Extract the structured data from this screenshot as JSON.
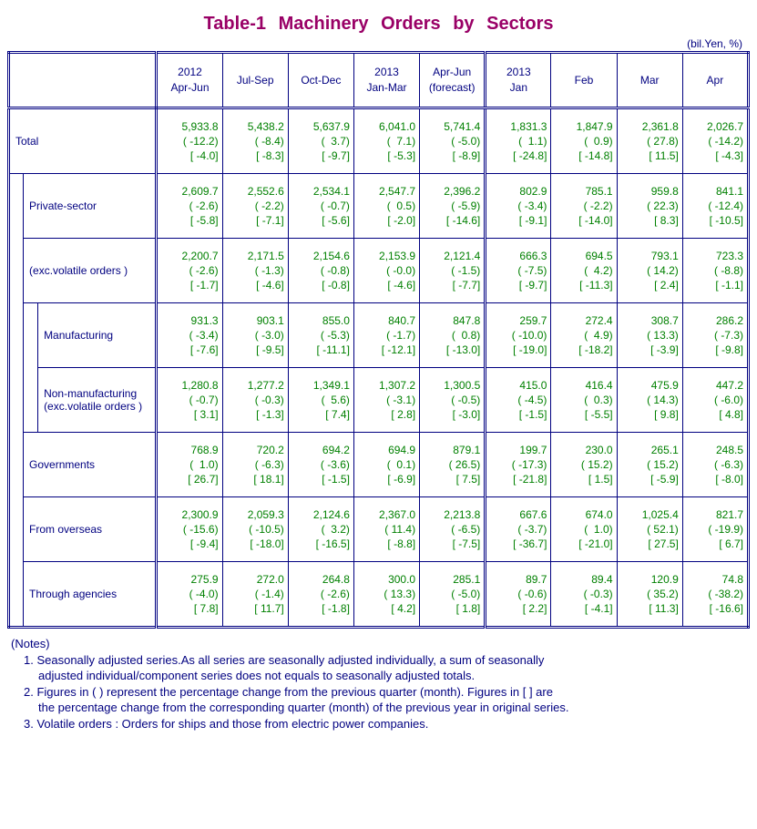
{
  "title": "Table-1   Machinery   Orders   by   Sectors",
  "unit": "(bil.Yen, %)",
  "header": {
    "q": [
      "2012\nApr-Jun",
      "Jul-Sep",
      "Oct-Dec",
      "2013\nJan-Mar",
      "Apr-Jun\n(forecast)"
    ],
    "m": [
      "2013\nJan",
      "Feb",
      "Mar",
      "Apr"
    ]
  },
  "rows": [
    {
      "label": "Total",
      "indent": 0,
      "cells": [
        "5,933.8\n( -12.2)\n[ -4.0]",
        "5,438.2\n( -8.4)\n[ -8.3]",
        "5,637.9\n(  3.7)\n[ -9.7]",
        "6,041.0\n(  7.1)\n[ -5.3]",
        "5,741.4\n( -5.0)\n[ -8.9]",
        "1,831.3\n(  1.1)\n[ -24.8]",
        "1,847.9\n(  0.9)\n[ -14.8]",
        "2,361.8\n( 27.8)\n[ 11.5]",
        "2,026.7\n( -14.2)\n[ -4.3]"
      ]
    },
    {
      "label": "Private-sector",
      "indent": 1,
      "cells": [
        "2,609.7\n( -2.6)\n[ -5.8]",
        "2,552.6\n( -2.2)\n[ -7.1]",
        "2,534.1\n( -0.7)\n[ -5.6]",
        "2,547.7\n(  0.5)\n[ -2.0]",
        "2,396.2\n( -5.9)\n[ -14.6]",
        "802.9\n( -3.4)\n[ -9.1]",
        "785.1\n( -2.2)\n[ -14.0]",
        "959.8\n( 22.3)\n[ 8.3]",
        "841.1\n( -12.4)\n[ -10.5]"
      ]
    },
    {
      "label": "(exc.volatile orders )",
      "indent": 1,
      "cells": [
        "2,200.7\n( -2.6)\n[ -1.7]",
        "2,171.5\n( -1.3)\n[ -4.6]",
        "2,154.6\n( -0.8)\n[ -0.8]",
        "2,153.9\n( -0.0)\n[ -4.6]",
        "2,121.4\n( -1.5)\n[ -7.7]",
        "666.3\n( -7.5)\n[ -9.7]",
        "694.5\n(  4.2)\n[ -11.3]",
        "793.1\n( 14.2)\n[ 2.4]",
        "723.3\n( -8.8)\n[ -1.1]"
      ]
    },
    {
      "label": "Manufacturing",
      "indent": 2,
      "cells": [
        "931.3\n( -3.4)\n[ -7.6]",
        "903.1\n( -3.0)\n[ -9.5]",
        "855.0\n( -5.3)\n[ -11.1]",
        "840.7\n( -1.7)\n[ -12.1]",
        "847.8\n(  0.8)\n[ -13.0]",
        "259.7\n( -10.0)\n[ -19.0]",
        "272.4\n(  4.9)\n[ -18.2]",
        "308.7\n( 13.3)\n[ -3.9]",
        "286.2\n( -7.3)\n[ -9.8]"
      ]
    },
    {
      "label": "Non-manufacturing\n(exc.volatile orders )",
      "indent": 2,
      "cells": [
        "1,280.8\n( -0.7)\n[ 3.1]",
        "1,277.2\n( -0.3)\n[ -1.3]",
        "1,349.1\n(  5.6)\n[ 7.4]",
        "1,307.2\n( -3.1)\n[ 2.8]",
        "1,300.5\n( -0.5)\n[ -3.0]",
        "415.0\n( -4.5)\n[ -1.5]",
        "416.4\n(  0.3)\n[ -5.5]",
        "475.9\n( 14.3)\n[ 9.8]",
        "447.2\n( -6.0)\n[ 4.8]"
      ]
    },
    {
      "label": "Governments",
      "indent": 1,
      "cells": [
        "768.9\n(  1.0)\n[ 26.7]",
        "720.2\n( -6.3)\n[ 18.1]",
        "694.2\n( -3.6)\n[ -1.5]",
        "694.9\n(  0.1)\n[ -6.9]",
        "879.1\n( 26.5)\n[ 7.5]",
        "199.7\n( -17.3)\n[ -21.8]",
        "230.0\n( 15.2)\n[ 1.5]",
        "265.1\n( 15.2)\n[ -5.9]",
        "248.5\n( -6.3)\n[ -8.0]"
      ]
    },
    {
      "label": "From overseas",
      "indent": 1,
      "cells": [
        "2,300.9\n( -15.6)\n[ -9.4]",
        "2,059.3\n( -10.5)\n[ -18.0]",
        "2,124.6\n(  3.2)\n[ -16.5]",
        "2,367.0\n( 11.4)\n[ -8.8]",
        "2,213.8\n( -6.5)\n[ -7.5]",
        "667.6\n( -3.7)\n[ -36.7]",
        "674.0\n(  1.0)\n[ -21.0]",
        "1,025.4\n( 52.1)\n[ 27.5]",
        "821.7\n( -19.9)\n[ 6.7]"
      ]
    },
    {
      "label": "Through agencies",
      "indent": 1,
      "cells": [
        "275.9\n( -4.0)\n[ 7.8]",
        "272.0\n( -1.4)\n[ 11.7]",
        "264.8\n( -2.6)\n[ -1.8]",
        "300.0\n( 13.3)\n[ 4.2]",
        "285.1\n( -5.0)\n[ 1.8]",
        "89.7\n( -0.6)\n[ 2.2]",
        "89.4\n( -0.3)\n[ -4.1]",
        "120.9\n( 35.2)\n[ 11.3]",
        "74.8\n( -38.2)\n[ -16.6]"
      ]
    }
  ],
  "notes": {
    "head": "(Notes)",
    "n1a": "1. Seasonally adjusted series.As all series are seasonally adjusted individually, a sum of seasonally",
    "n1b": "adjusted individual/component series does not equals to seasonally adjusted totals.",
    "n2a": "2. Figures in ( ) represent the percentage change from the previous quarter (month). Figures in [ ] are",
    "n2b": "the percentage change from the corresponding quarter (month) of the previous year in original series.",
    "n3": "3. Volatile orders : Orders for ships and those from electric power companies."
  },
  "chart_data": {
    "type": "table",
    "unit": "bil.Yen, %",
    "columns_quarterly": [
      "2012 Apr-Jun",
      "2012 Jul-Sep",
      "2012 Oct-Dec",
      "2013 Jan-Mar",
      "2013 Apr-Jun (forecast)"
    ],
    "columns_monthly": [
      "2013 Jan",
      "2013 Feb",
      "2013 Mar",
      "2013 Apr"
    ],
    "series": [
      {
        "name": "Total",
        "values": [
          5933.8,
          5438.2,
          5637.9,
          6041.0,
          5741.4,
          1831.3,
          1847.9,
          2361.8,
          2026.7
        ],
        "pct_prev": [
          -12.2,
          -8.4,
          3.7,
          7.1,
          -5.0,
          1.1,
          0.9,
          27.8,
          -14.2
        ],
        "pct_yoy": [
          -4.0,
          -8.3,
          -9.7,
          -5.3,
          -8.9,
          -24.8,
          -14.8,
          11.5,
          -4.3
        ]
      },
      {
        "name": "Private-sector",
        "values": [
          2609.7,
          2552.6,
          2534.1,
          2547.7,
          2396.2,
          802.9,
          785.1,
          959.8,
          841.1
        ],
        "pct_prev": [
          -2.6,
          -2.2,
          -0.7,
          0.5,
          -5.9,
          -3.4,
          -2.2,
          22.3,
          -12.4
        ],
        "pct_yoy": [
          -5.8,
          -7.1,
          -5.6,
          -2.0,
          -14.6,
          -9.1,
          -14.0,
          8.3,
          -10.5
        ]
      },
      {
        "name": "Private-sector (exc.volatile orders)",
        "values": [
          2200.7,
          2171.5,
          2154.6,
          2153.9,
          2121.4,
          666.3,
          694.5,
          793.1,
          723.3
        ],
        "pct_prev": [
          -2.6,
          -1.3,
          -0.8,
          -0.0,
          -1.5,
          -7.5,
          4.2,
          14.2,
          -8.8
        ],
        "pct_yoy": [
          -1.7,
          -4.6,
          -0.8,
          -4.6,
          -7.7,
          -9.7,
          -11.3,
          2.4,
          -1.1
        ]
      },
      {
        "name": "Manufacturing",
        "values": [
          931.3,
          903.1,
          855.0,
          840.7,
          847.8,
          259.7,
          272.4,
          308.7,
          286.2
        ],
        "pct_prev": [
          -3.4,
          -3.0,
          -5.3,
          -1.7,
          0.8,
          -10.0,
          4.9,
          13.3,
          -7.3
        ],
        "pct_yoy": [
          -7.6,
          -9.5,
          -11.1,
          -12.1,
          -13.0,
          -19.0,
          -18.2,
          -3.9,
          -9.8
        ]
      },
      {
        "name": "Non-manufacturing (exc.volatile orders)",
        "values": [
          1280.8,
          1277.2,
          1349.1,
          1307.2,
          1300.5,
          415.0,
          416.4,
          475.9,
          447.2
        ],
        "pct_prev": [
          -0.7,
          -0.3,
          5.6,
          -3.1,
          -0.5,
          -4.5,
          0.3,
          14.3,
          -6.0
        ],
        "pct_yoy": [
          3.1,
          -1.3,
          7.4,
          2.8,
          -3.0,
          -1.5,
          -5.5,
          9.8,
          4.8
        ]
      },
      {
        "name": "Governments",
        "values": [
          768.9,
          720.2,
          694.2,
          694.9,
          879.1,
          199.7,
          230.0,
          265.1,
          248.5
        ],
        "pct_prev": [
          1.0,
          -6.3,
          -3.6,
          0.1,
          26.5,
          -17.3,
          15.2,
          15.2,
          -6.3
        ],
        "pct_yoy": [
          26.7,
          18.1,
          -1.5,
          -6.9,
          7.5,
          -21.8,
          1.5,
          -5.9,
          -8.0
        ]
      },
      {
        "name": "From overseas",
        "values": [
          2300.9,
          2059.3,
          2124.6,
          2367.0,
          2213.8,
          667.6,
          674.0,
          1025.4,
          821.7
        ],
        "pct_prev": [
          -15.6,
          -10.5,
          3.2,
          11.4,
          -6.5,
          -3.7,
          1.0,
          52.1,
          -19.9
        ],
        "pct_yoy": [
          -9.4,
          -18.0,
          -16.5,
          -8.8,
          -7.5,
          -36.7,
          -21.0,
          27.5,
          6.7
        ]
      },
      {
        "name": "Through agencies",
        "values": [
          275.9,
          272.0,
          264.8,
          300.0,
          285.1,
          89.7,
          89.4,
          120.9,
          74.8
        ],
        "pct_prev": [
          -4.0,
          -1.4,
          -2.6,
          13.3,
          -5.0,
          -0.6,
          -0.3,
          35.2,
          -38.2
        ],
        "pct_yoy": [
          7.8,
          11.7,
          -1.8,
          4.2,
          1.8,
          2.2,
          -4.1,
          11.3,
          -16.6
        ]
      }
    ]
  }
}
